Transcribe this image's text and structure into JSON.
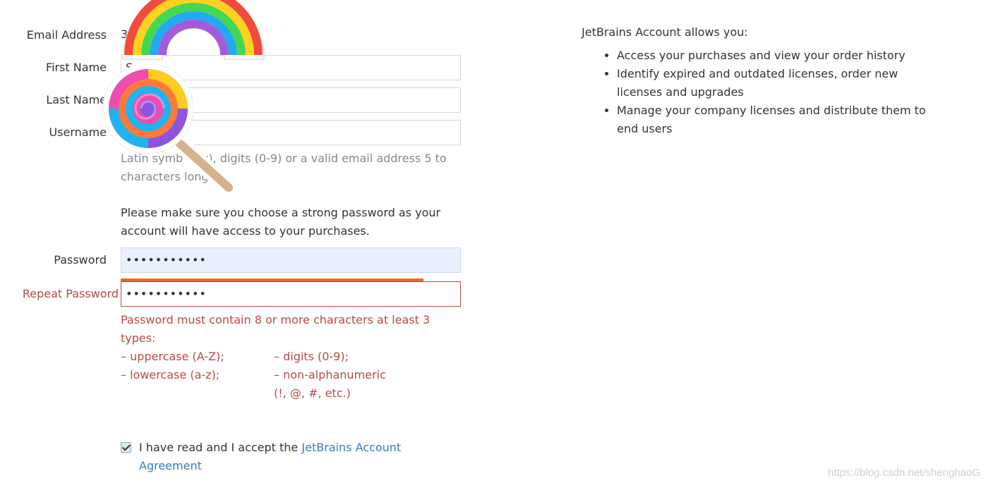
{
  "form": {
    "email_label": "Email Address",
    "email_value": "3",
    "first_name_label": "First Name",
    "first_name_value": "S",
    "last_name_label": "Last Name",
    "last_name_value": "",
    "username_label": "Username",
    "username_value": "",
    "username_hint": "Latin symb (A-z), digits (0-9) or a valid email address 5 to characters long.",
    "password_note": "Please make sure you choose a strong password as your account will have access to your purchases.",
    "password_label": "Password",
    "password_value": "•••••••••••",
    "repeat_label": "Repeat Password",
    "repeat_value": "•••••••••••",
    "error_main": "Password must contain 8 or more characters at least 3 types:",
    "error_upper": "– uppercase (A-Z);",
    "error_lower": "– lowercase (a-z);",
    "error_digits": "– digits (0-9);",
    "error_nonalpha": "– non-alphanumeric",
    "error_nonalpha_examples": "(!, @, #, etc.)",
    "agree_text": "I have read and I accept the",
    "agree_link": "JetBrains Account Agreement"
  },
  "right": {
    "heading": "JetBrains Account allows you:",
    "items": [
      "Access your purchases and view your order history",
      "Identify expired and outdated licenses, order new licenses and upgrades",
      "Manage your company licenses and distribute them to end users"
    ]
  },
  "watermark": "https://blog.csdn.net/shenghaoG",
  "colors": {
    "error": "#b94a48",
    "link": "#3a7abf",
    "strength_bar": "#f26522",
    "autofill": "#e8f0fe"
  },
  "stickers": [
    "rainbow-sticker",
    "lollipop-sticker"
  ]
}
